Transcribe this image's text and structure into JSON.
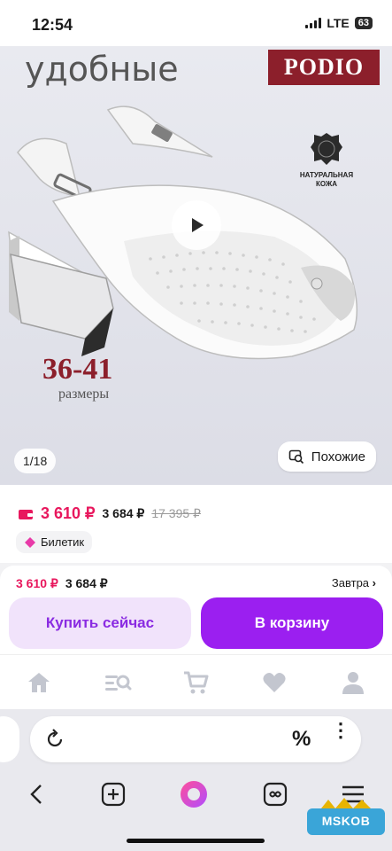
{
  "status": {
    "time": "12:54",
    "network": "LTE",
    "battery": "63"
  },
  "hero": {
    "heading": "удобные",
    "brand": "PODIO",
    "leather_badge": "НАТУРАЛЬНАЯ КОЖА",
    "size_range": "36-41",
    "size_label": "размеры",
    "image_counter": "1/18",
    "similar_label": "Похожие",
    "play_icon": "play-icon"
  },
  "price": {
    "main": "3 610 ₽",
    "alt": "3 684 ₽",
    "old": "17 395 ₽",
    "ticket_label": "Билетик",
    "accent_color": "#e8175d"
  },
  "buy_panel": {
    "price_main": "3 610 ₽",
    "price_alt": "3 684 ₽",
    "delivery": "Завтра",
    "buy_now": "Купить сейчас",
    "add_to_cart": "В корзину",
    "cart_color": "#9b1ff0"
  },
  "tabbar": {
    "icons": [
      "home-icon",
      "catalog-search-icon",
      "cart-icon",
      "favorites-icon",
      "profile-icon"
    ]
  },
  "browser": {
    "url_percent": "%",
    "nav_icons": [
      "back-icon",
      "new-tab-icon",
      "alice-icon",
      "tabs-icon",
      "menu-icon"
    ]
  },
  "watermark": "MSKOB"
}
